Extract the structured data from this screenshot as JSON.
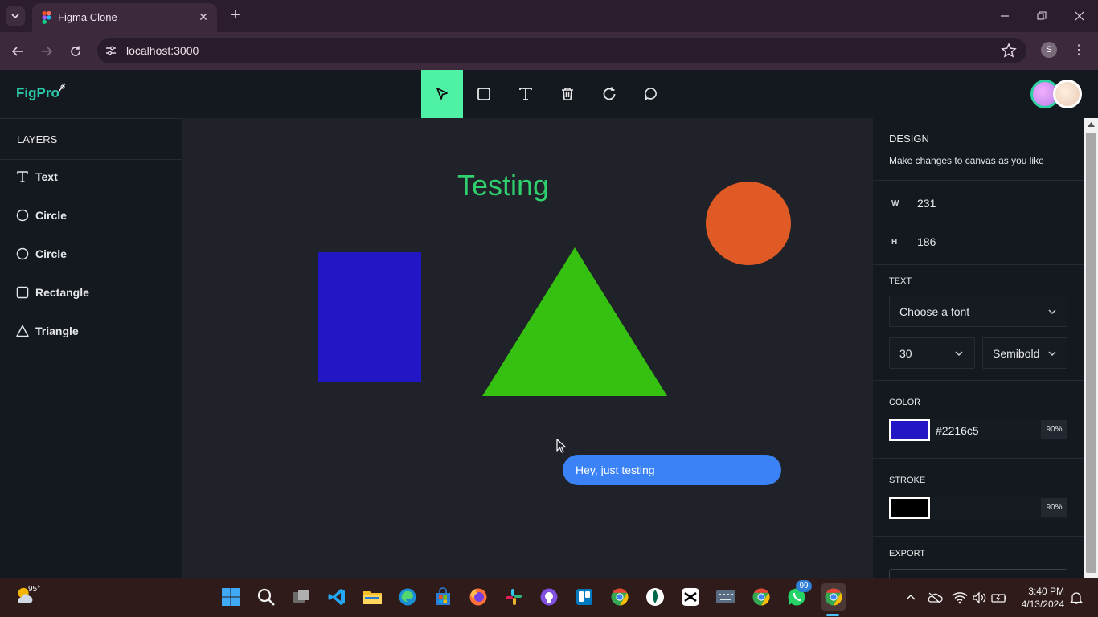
{
  "browser": {
    "tab_title": "Figma Clone",
    "url": "localhost:3000",
    "profile_initial": "S"
  },
  "app": {
    "logo_text": "FigPro",
    "toolbar_tools": [
      "select-icon",
      "rectangle-icon",
      "text-icon",
      "trash-icon",
      "reset-icon",
      "comment-icon"
    ],
    "active_tool": "select-icon",
    "accent_color": "#4ff2a4"
  },
  "layers": {
    "title": "LAYERS",
    "items": [
      {
        "label": "Text",
        "icon": "text-icon"
      },
      {
        "label": "Circle",
        "icon": "circle-icon"
      },
      {
        "label": "Circle",
        "icon": "circle-icon"
      },
      {
        "label": "Rectangle",
        "icon": "rectangle-icon"
      },
      {
        "label": "Triangle",
        "icon": "triangle-icon"
      }
    ]
  },
  "canvas": {
    "text_object": {
      "text": "Testing",
      "color": "#2fcf6e"
    },
    "rectangle": {
      "color": "#2216c5"
    },
    "triangle": {
      "color": "#36c112"
    },
    "circle": {
      "color": "#e05a25"
    },
    "comment": {
      "text": "Hey, just testing",
      "color": "#3b82f6"
    }
  },
  "design": {
    "title": "DESIGN",
    "subtitle": "Make changes to canvas as you like",
    "width_label": "W",
    "width_value": "231",
    "height_label": "H",
    "height_value": "186",
    "text_section": "TEXT",
    "font_family_placeholder": "Choose a font",
    "font_size": "30",
    "font_weight": "Semibold",
    "color_section": "COLOR",
    "fill_hex": "#2216c5",
    "fill_opacity": "90%",
    "stroke_section": "STROKE",
    "stroke_color": "#000000",
    "stroke_opacity": "90%",
    "export_section": "EXPORT"
  },
  "taskbar": {
    "weather_temp": "95°",
    "whatsapp_badge": "99",
    "time": "3:40 PM",
    "date": "4/13/2024"
  }
}
